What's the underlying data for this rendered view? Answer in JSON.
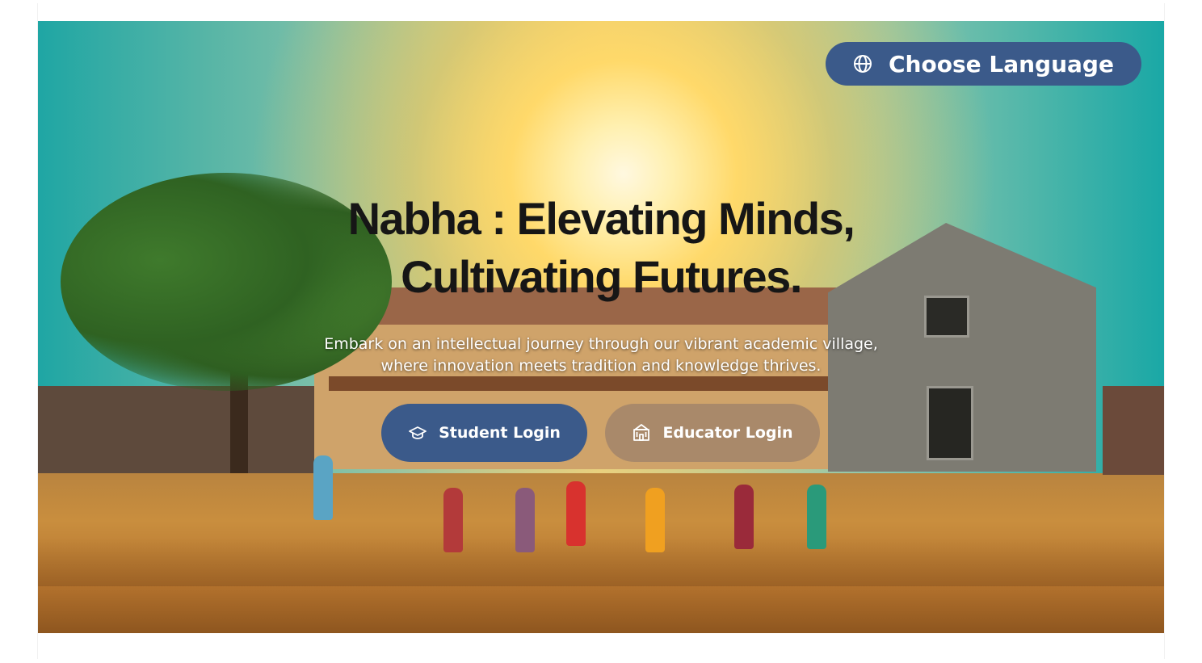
{
  "header": {
    "language_button_label": "Choose Language"
  },
  "hero": {
    "title_line1": "Nabha : Elevating Minds,",
    "title_line2": "Cultivating Futures.",
    "subtitle_line1": "Embark on an intellectual journey through our vibrant academic village,",
    "subtitle_line2": "where innovation meets tradition and knowledge thrives."
  },
  "actions": {
    "student_login_label": "Student Login",
    "educator_login_label": "Educator Login"
  },
  "icons": {
    "language": "globe-icon",
    "student": "graduation-cap-icon",
    "educator": "school-building-icon"
  },
  "colors": {
    "primary_button": "#3b5a8a",
    "secondary_button": "#a9896a",
    "title_text": "#161616"
  }
}
